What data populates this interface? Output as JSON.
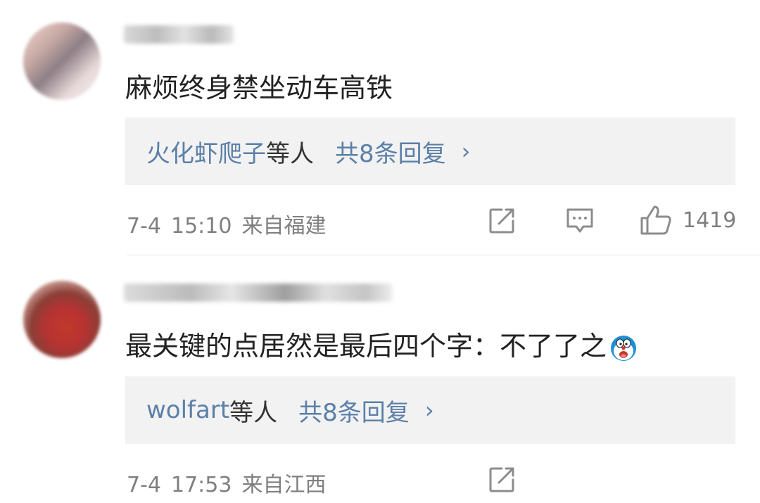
{
  "comments": [
    {
      "text": "麻烦终身禁坐动车高铁",
      "reply_preview": {
        "users": "火化虾爬子",
        "suffix": "等人",
        "total": "共8条回复",
        "chevron": "›"
      },
      "time": "7-4",
      "clock": "15:10",
      "location": "来自福建",
      "likes": "1419",
      "icons": [
        "repost-icon",
        "comment-icon",
        "thumbs-up-icon"
      ]
    },
    {
      "text": "最关键的点居然是最后四个字：不了了之",
      "emoji": "doraemon-emoji",
      "reply_preview": {
        "users": "wolfart",
        "suffix": "等人",
        "total": "共8条回复",
        "chevron": "›"
      },
      "time": "7-4",
      "clock": "17:53",
      "location": "来自江西",
      "icons": [
        "repost-icon"
      ]
    }
  ],
  "colors": {
    "link_blue": "#5b80a8",
    "meta_gray": "#7f7f7f",
    "reply_bg": "#f2f2f2"
  }
}
